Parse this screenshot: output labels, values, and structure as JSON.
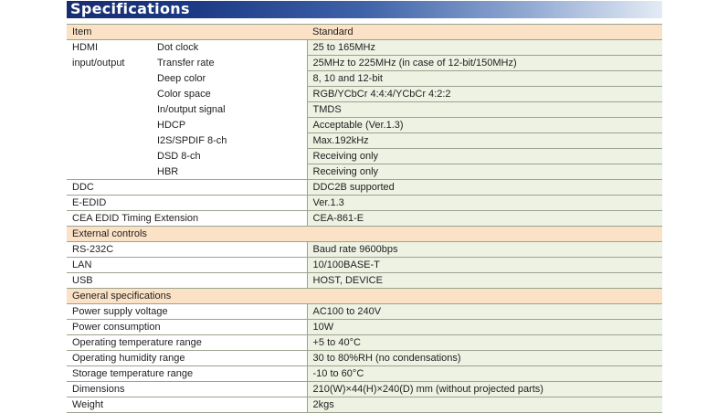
{
  "title": "Specifications",
  "header": {
    "item": "Item",
    "standard": "Standard"
  },
  "hdmi": {
    "group_line1": "HDMI",
    "group_line2": "input/output",
    "rows": [
      {
        "label": "Dot clock",
        "value": "25 to 165MHz"
      },
      {
        "label": "Transfer rate",
        "value": "25MHz to 225MHz (in case of 12-bit/150MHz)"
      },
      {
        "label": "Deep color",
        "value": "8, 10 and 12-bit"
      },
      {
        "label": "Color space",
        "value": "RGB/YCbCr 4:4:4/YCbCr 4:2:2"
      },
      {
        "label": "In/output signal",
        "value": "TMDS"
      },
      {
        "label": "HDCP",
        "value": "Acceptable (Ver.1.3)"
      },
      {
        "label": "I2S/SPDIF 8-ch",
        "value": "Max.192kHz"
      },
      {
        "label": "DSD 8-ch",
        "value": "Receiving only"
      },
      {
        "label": "HBR",
        "value": "Receiving only"
      }
    ]
  },
  "misc_rows": [
    {
      "label": "DDC",
      "value": "DDC2B supported"
    },
    {
      "label": "E-EDID",
      "value": "Ver.1.3"
    },
    {
      "label": "CEA EDID Timing Extension",
      "value": "CEA-861-E"
    }
  ],
  "external": {
    "title": "External controls",
    "rows": [
      {
        "label": "RS-232C",
        "value": "Baud rate 9600bps"
      },
      {
        "label": "LAN",
        "value": "10/100BASE-T"
      },
      {
        "label": "USB",
        "value": "HOST, DEVICE"
      }
    ]
  },
  "general": {
    "title": "General specifications",
    "rows": [
      {
        "label": "Power supply voltage",
        "value": "AC100 to 240V"
      },
      {
        "label": "Power consumption",
        "value": "10W"
      },
      {
        "label": "Operating temperature range",
        "value": "+5 to 40°C"
      },
      {
        "label": "Operating humidity range",
        "value": "30 to 80%RH (no condensations)"
      },
      {
        "label": "Storage temperature range",
        "value": "-10 to 60°C"
      },
      {
        "label": "Dimensions",
        "value": "210(W)×44(H)×240(D) mm (without projected parts)"
      },
      {
        "label": "Weight",
        "value": "2kgs"
      }
    ]
  },
  "colors": {
    "banner_dark": "#172d70",
    "header_fill": "#fbe2c6",
    "value_fill": "#eef2e3",
    "rule": "#9aa38f"
  }
}
